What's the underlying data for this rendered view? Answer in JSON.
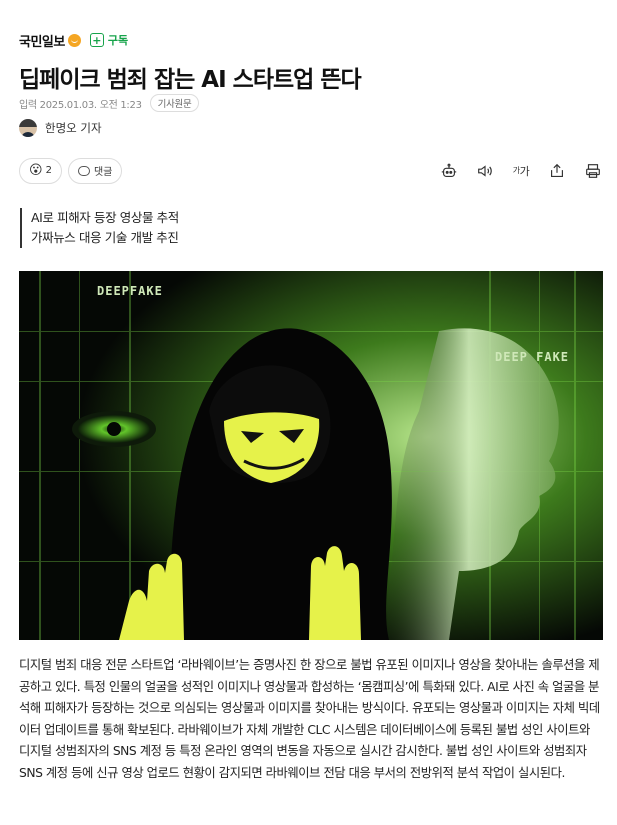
{
  "masthead": {
    "brand": "국민일보",
    "subscribe_label": "구독"
  },
  "article": {
    "headline": "딥페이크 범죄 잡는 AI 스타트업 뜬다",
    "dateline": "입력 2025.01.03. 오전 1:23",
    "original_link": "기사원문",
    "author": "한명오 기자",
    "summary": [
      "AI로 피해자 등장 영상물 추적",
      "가짜뉴스 대응 기술 개발 추진"
    ],
    "image_watermarks": [
      "DEEPFAKE",
      "DEEP FAKE"
    ],
    "body": "디지털 범죄 대응 전문 스타트업 ‘라바웨이브’는 증명사진 한 장으로 불법 유포된 이미지나 영상을 찾아내는 솔루션을 제공하고 있다. 특정 인물의 얼굴을 성적인 이미지나 영상물과 합성하는 ‘몸캠피싱’에 특화돼 있다. AI로 사진 속 얼굴을 분석해 피해자가 등장하는 것으로 의심되는 영상물과 이미지를 찾아내는 방식이다. 유포되는 영상물과 이미지는 자체 빅데이터 업데이트를 통해 확보된다. 라바웨이브가 자체 개발한 CLC 시스템은 데이터베이스에 등록된 불법 성인 사이트와 디지털 성범죄자의 SNS 계정 등 특정 온라인 영역의 변동을 자동으로 실시간 감시한다. 불법 성인 사이트와 성범죄자 SNS 계정 등에 신규 영상 업로드 현황이 감지되면 라바웨이브 전담 대응 부서의 전방위적 분석 작업이 실시된다."
  },
  "actions": {
    "reaction_count": "2",
    "comment_label": "댓글",
    "font_size_label": "가",
    "tools": [
      "robot-icon",
      "speaker-icon",
      "font-size-icon",
      "share-icon",
      "print-icon"
    ]
  },
  "colors": {
    "accent": "#16a34a",
    "brand_badge": "#f5a623"
  }
}
